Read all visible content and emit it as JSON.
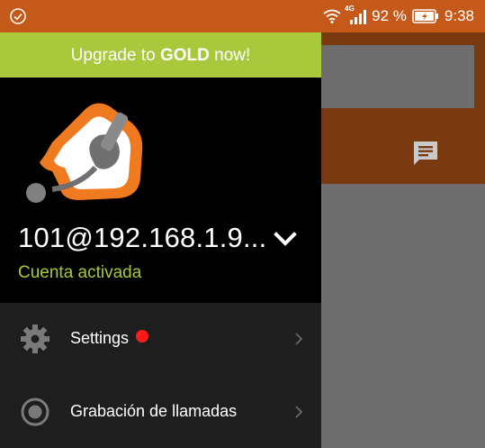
{
  "status_bar": {
    "network_label": "4G",
    "battery_percent": "92 %",
    "time": "9:38"
  },
  "drawer": {
    "upgrade_prefix": "Upgrade to ",
    "upgrade_bold": "GOLD",
    "upgrade_suffix": " now!",
    "account": "101@192.168.1.9...",
    "account_status": "Cuenta activada",
    "menu": [
      {
        "label": "Settings",
        "icon": "gear-icon",
        "badge": "red-dot"
      },
      {
        "label": "Grabación de llamadas",
        "icon": "record-icon"
      }
    ]
  },
  "colors": {
    "status_bar": "#c4591a",
    "upgrade_banner": "#a9c83c",
    "account_status": "#a9c83c",
    "badge": "#ff1a1a"
  }
}
